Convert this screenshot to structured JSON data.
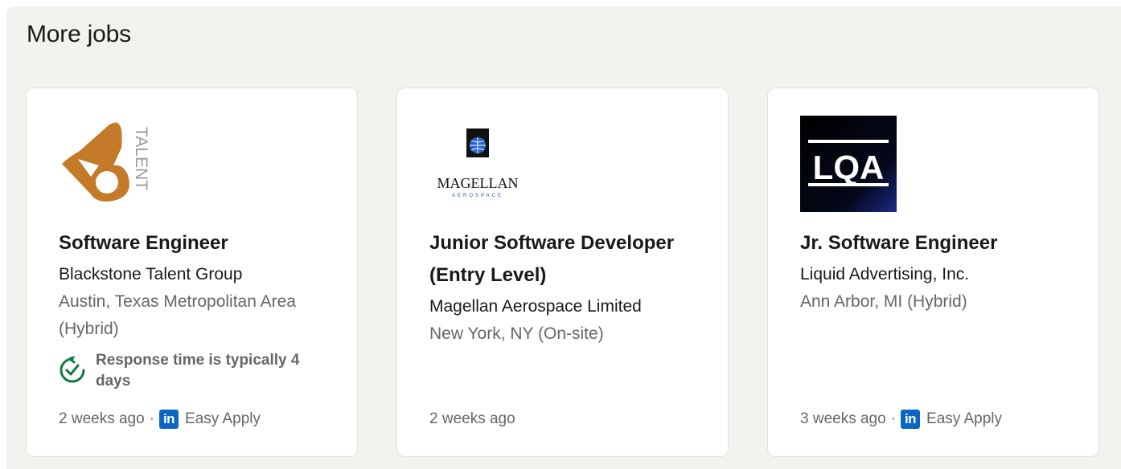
{
  "section": {
    "title": "More jobs"
  },
  "jobs": [
    {
      "logo_icon": "blackstone-talent-logo",
      "logo_text": "TALENT",
      "title": "Software Engineer",
      "company": "Blackstone Talent Group",
      "location": "Austin, Texas Metropolitan Area (Hybrid)",
      "insight": "Response time is typically 4 days",
      "insight_icon": "response-time-icon",
      "posted": "2 weeks ago",
      "separator": "·",
      "apply_label": "Easy Apply",
      "apply_icon": "linkedin-icon"
    },
    {
      "logo_icon": "magellan-aerospace-logo",
      "logo_text": "MAGELLAN",
      "logo_subtext": "AEROSPACE",
      "title": "Junior Software Developer (Entry Level)",
      "company": "Magellan Aerospace Limited",
      "location": "New York, NY (On-site)",
      "posted": "2 weeks ago"
    },
    {
      "logo_icon": "lqa-logo",
      "logo_text": "LQA",
      "title": "Jr. Software Engineer",
      "company": "Liquid Advertising, Inc.",
      "location": "Ann Arbor, MI (Hybrid)",
      "posted": "3 weeks ago",
      "separator": "·",
      "apply_label": "Easy Apply",
      "apply_icon": "linkedin-icon",
      "apply_icon_text": "in"
    }
  ],
  "colors": {
    "section_bg": "#f4f2ee",
    "card_bg": "#ffffff",
    "linkedin_blue": "#0a66c2",
    "insight_green": "#0d7a45",
    "talent_orange": "#c57a2a",
    "muted_text": "#666666"
  }
}
